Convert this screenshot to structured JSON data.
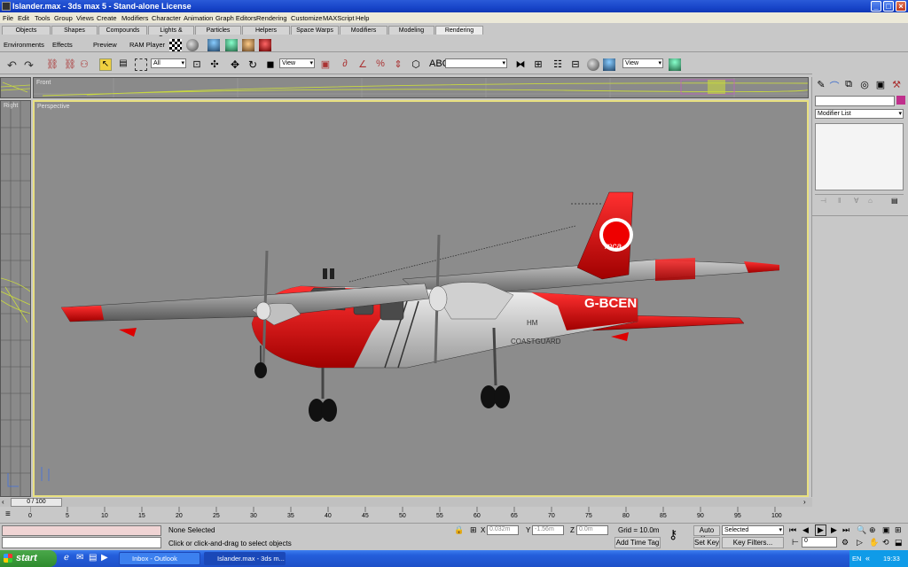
{
  "window": {
    "title": "Islander.max - 3ds max 5 - Stand-alone License"
  },
  "menu": [
    "File",
    "Edit",
    "Tools",
    "Group",
    "Views",
    "Create",
    "Modifiers",
    "Character",
    "Animation",
    "Graph Editors",
    "Rendering",
    "Customize",
    "MAXScript",
    "Help"
  ],
  "tabs": [
    "Objects",
    "Shapes",
    "Compounds",
    "Lights & Cameras",
    "Particles",
    "Helpers",
    "Space Warps",
    "Modifiers",
    "Modeling",
    "Rendering"
  ],
  "active_tab": "Rendering",
  "row2": {
    "environments": "Environments",
    "effects": "Effects",
    "preview": "Preview",
    "ram_player": "RAM Player"
  },
  "toolbar": {
    "selection_filter": "All",
    "ref_coord": "View",
    "named_sel": "",
    "view2": "View"
  },
  "viewports": {
    "front": "Front",
    "right": "Right",
    "perspective": "Perspective"
  },
  "aircraft": {
    "registration": "G-BCEN",
    "line1": "HM",
    "line2": "COASTGUARD",
    "logo": "mca"
  },
  "command_panel": {
    "modifier_list": "Modifier List"
  },
  "timeline": {
    "frame": "0 / 100",
    "ticks": [
      "0",
      "5",
      "10",
      "15",
      "20",
      "25",
      "30",
      "35",
      "40",
      "45",
      "50",
      "55",
      "60",
      "65",
      "70",
      "75",
      "80",
      "85",
      "90",
      "95",
      "100"
    ]
  },
  "status": {
    "selection": "None Selected",
    "prompt": "Click or click-and-drag to select objects",
    "x_label": "X",
    "x": "0.032m",
    "y_label": "Y",
    "y": "-1.56m",
    "z_label": "Z",
    "z": "0.0m",
    "grid": "Grid = 10.0m",
    "add_time_tag": "Add Time Tag",
    "auto_key": "Auto Key",
    "set_key": "Set Key",
    "key_mode": "Selected",
    "key_filters": "Key Filters...",
    "current_frame": "0"
  },
  "taskbar": {
    "start": "start",
    "tasks": [
      "Inbox - Outlook Express",
      "Islander.max - 3ds m..."
    ],
    "lang": "EN",
    "clock": "19:33"
  }
}
